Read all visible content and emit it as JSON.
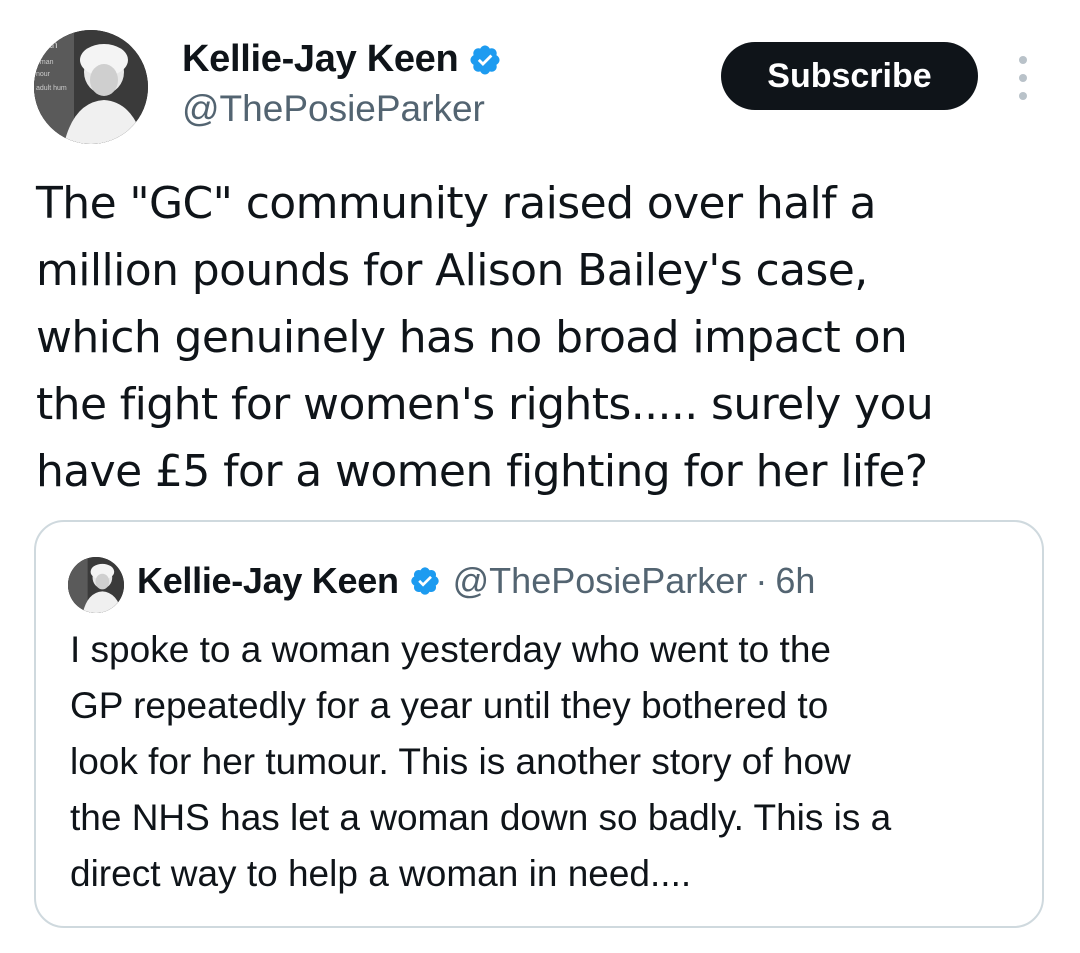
{
  "tweet": {
    "author": {
      "name": "Kellie-Jay Keen",
      "handle": "@ThePosieParker",
      "verified": true
    },
    "subscribe_label": "Subscribe",
    "text": "The \"GC\" community raised over half a\nmillion pounds for Alison Bailey's case,\nwhich genuinely has no broad impact on\nthe fight for women's rights.....  surely you\nhave £5 for a women fighting for her life?"
  },
  "quoted_tweet": {
    "author": {
      "name": "Kellie-Jay Keen",
      "handle": "@ThePosieParker",
      "verified": true
    },
    "separator": "·",
    "time": "6h",
    "text": "I spoke to a woman yesterday who went to the\nGP repeatedly for a year until they bothered to\nlook for her tumour.  This is another story of how\nthe NHS has let a woman down so badly. This is a\ndirect way to help a woman in need...."
  },
  "colors": {
    "verified": "#1d9bf0",
    "text_primary": "#0f1419",
    "text_secondary": "#536471",
    "border": "#cfd9de",
    "button_bg": "#0f1419"
  },
  "icons": {
    "verified": "verified-badge-icon",
    "more": "more-vertical-icon"
  },
  "avatar_text": [
    "man",
    "oman",
    "nour",
    "adult hum"
  ]
}
